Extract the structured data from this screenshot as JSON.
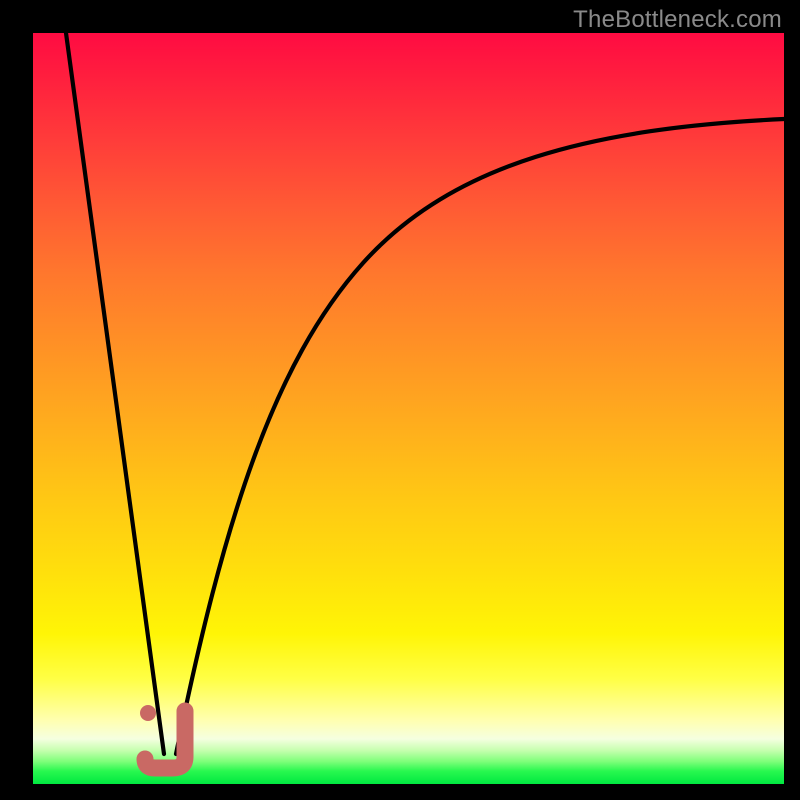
{
  "attribution": "TheBottleneck.com",
  "colors": {
    "frame": "#000000",
    "curve": "#000000",
    "marker": "#c96964",
    "gradient_top": "#ff0b42",
    "gradient_bottom": "#00e840"
  },
  "chart_data": {
    "type": "line",
    "title": "",
    "xlabel": "",
    "ylabel": "",
    "xlim": [
      0,
      100
    ],
    "ylim": [
      0,
      100
    ],
    "grid": false,
    "legend": false,
    "series": [
      {
        "name": "left-descent",
        "x": [
          4.4,
          17.5
        ],
        "y": [
          100,
          4
        ],
        "note": "steep near-linear descent from top-left into the valley"
      },
      {
        "name": "right-ascent",
        "x": [
          19,
          22,
          25,
          28,
          32,
          36,
          41,
          47,
          54,
          62,
          71,
          81,
          91,
          100
        ],
        "y": [
          4,
          15,
          26,
          35,
          44,
          52,
          59,
          66,
          72,
          77,
          81,
          84.5,
          87,
          88.5
        ],
        "note": "concave-down rise that levels off toward upper right"
      }
    ],
    "marker": {
      "name": "J-mark",
      "approx_bbox_xy": {
        "x_min": 14.5,
        "x_max": 20.5,
        "y_min": 3,
        "y_max": 10
      },
      "dot_xy": {
        "x": 15.3,
        "y": 9.5
      }
    },
    "background": {
      "type": "vertical-gradient",
      "meaning": "red = high bottleneck, green = low bottleneck",
      "green_band_y_range": [
        0,
        6
      ]
    }
  }
}
